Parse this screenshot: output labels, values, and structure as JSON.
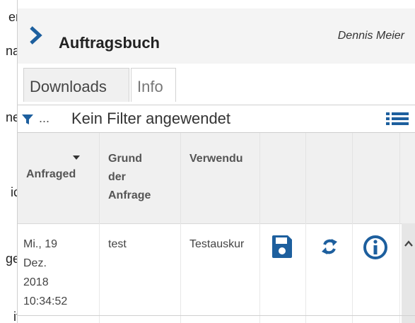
{
  "edge_text": [
    "er",
    "na",
    "ne",
    "ic",
    "ge",
    "it"
  ],
  "header": {
    "title": "Auftragsbuch",
    "user": "Dennis Meier"
  },
  "tabs": [
    {
      "label": "Downloads",
      "active": true
    },
    {
      "label": "Info",
      "active": false
    }
  ],
  "filter": {
    "ellipsis": "...",
    "text": "Kein Filter angewendet"
  },
  "table": {
    "columns": [
      {
        "label": "Anfraged",
        "sorted": true
      },
      {
        "label_lines": [
          "Grund",
          "der",
          "Anfrage"
        ]
      },
      {
        "label": "Verwendu"
      }
    ],
    "rows": [
      {
        "date_lines": [
          "Mi., 19",
          "Dez.",
          "2018",
          "10:34:52"
        ],
        "reason": "test",
        "usage": "Testauskur",
        "actions": [
          "save-icon",
          "refresh-icon",
          "info-icon"
        ]
      }
    ]
  },
  "colors": {
    "accent": "#1d5f9e",
    "header_bg": "#f4f4f4",
    "table_header_bg": "#f0f0f0",
    "scroll_bg": "#e6e6e6"
  }
}
